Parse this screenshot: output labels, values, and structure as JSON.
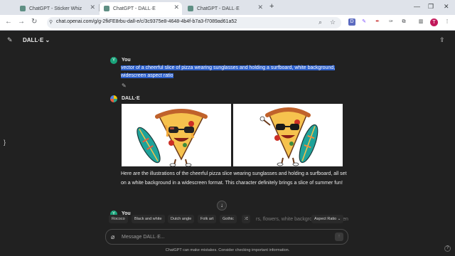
{
  "browser": {
    "tabs": [
      {
        "label": "ChatGPT - Sticker Whiz",
        "active": false
      },
      {
        "label": "ChatGPT - DALL·E",
        "active": true
      },
      {
        "label": "ChatGPT - DALL·E",
        "active": false
      }
    ],
    "new_tab": "+",
    "url": "chat.openai.com/g/g-2fkFE8rbu-dall-e/c/3c9375e8-4648-4b4f-b7a3-f7089ad61a52",
    "profile_initial": "T",
    "icons": [
      "back-icon",
      "forward-icon",
      "reload-icon",
      "zoom-icon",
      "star-icon",
      "extension-icon",
      "profile-icon"
    ]
  },
  "app": {
    "model_name": "DALL·E ⌄",
    "messages": {
      "user_name": "You",
      "user_avatar": "Y",
      "prompt": "vector of a cheerful slice of pizza wearing sunglasses and holding a surfboard, white background, widescreen aspect ratio",
      "assistant_name": "DALL·E",
      "reply": "Here are the illustrations of the cheerful pizza slice wearing sunglasses and holding a surfboard, all set on a white background in a widescreen format. This character definitely brings a slice of summer fun!",
      "user_name_2": "You",
      "behind_text": "rs, flowers, white background, widescreen"
    },
    "style_chips": [
      "Rococo",
      "Black and white",
      "Dutch angle",
      "Folk art",
      "Gothic",
      "⤮",
      "Aspect Ratio ⌄"
    ],
    "composer": {
      "placeholder": "Message DALL·E..."
    },
    "disclaimer": "ChatGPT can make mistakes. Consider checking important information.",
    "help": "?"
  }
}
